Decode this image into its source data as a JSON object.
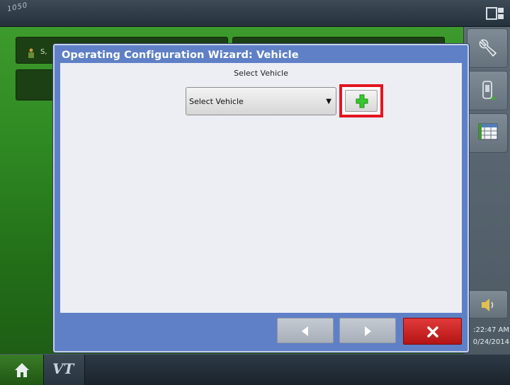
{
  "topbar": {
    "logo_text": "1050"
  },
  "background": {
    "tab_text": "S,"
  },
  "dialog": {
    "title": "Operating Configuration Wizard:  Vehicle",
    "select_label": "Select Vehicle",
    "select_value": "Select Vehicle",
    "add_icon": "green-plus-icon",
    "buttons": {
      "back": "left-arrow-icon",
      "next": "right-arrow-icon",
      "cancel": "x-icon"
    }
  },
  "sidebar": {
    "items": [
      "wrench-icon",
      "display-monitor-icon",
      "grid-icon",
      "speaker-icon"
    ],
    "time": ":22:47 AM",
    "date": "0/24/2014"
  },
  "bottombar": {
    "home_icon": "home-icon",
    "vt_label": "VT"
  },
  "colors": {
    "dialog_title_bg": "#5f80c6",
    "add_highlight": "#e3151f",
    "cancel": "#c82020",
    "green_bg": "#2f8a23"
  }
}
